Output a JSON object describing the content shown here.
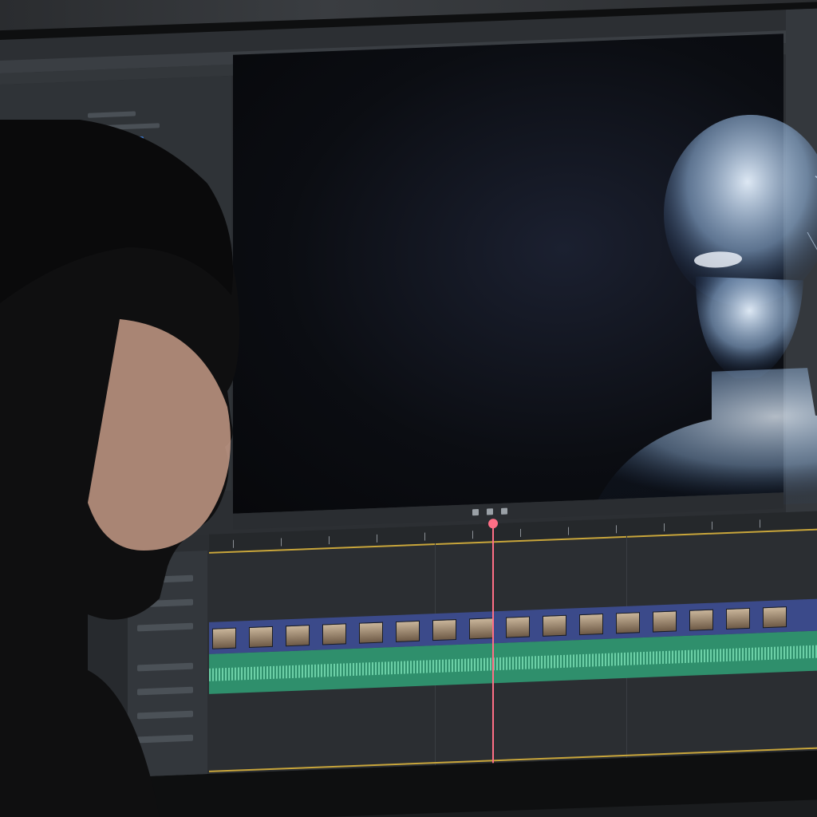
{
  "scene": {
    "description_free": true
  },
  "colors": {
    "ui_bg": "#2c2f33",
    "viewer_bg": "#0b0d12",
    "video_track": "#3b4a8a",
    "audio_track": "#2f8f6c",
    "playhead": "#ff6f86",
    "ruler_accent": "#c9a63b",
    "hologram": "#cfe6ff"
  },
  "icons": {
    "play": "play-icon",
    "rewind": "rewind-icon",
    "forward": "forward-icon"
  }
}
